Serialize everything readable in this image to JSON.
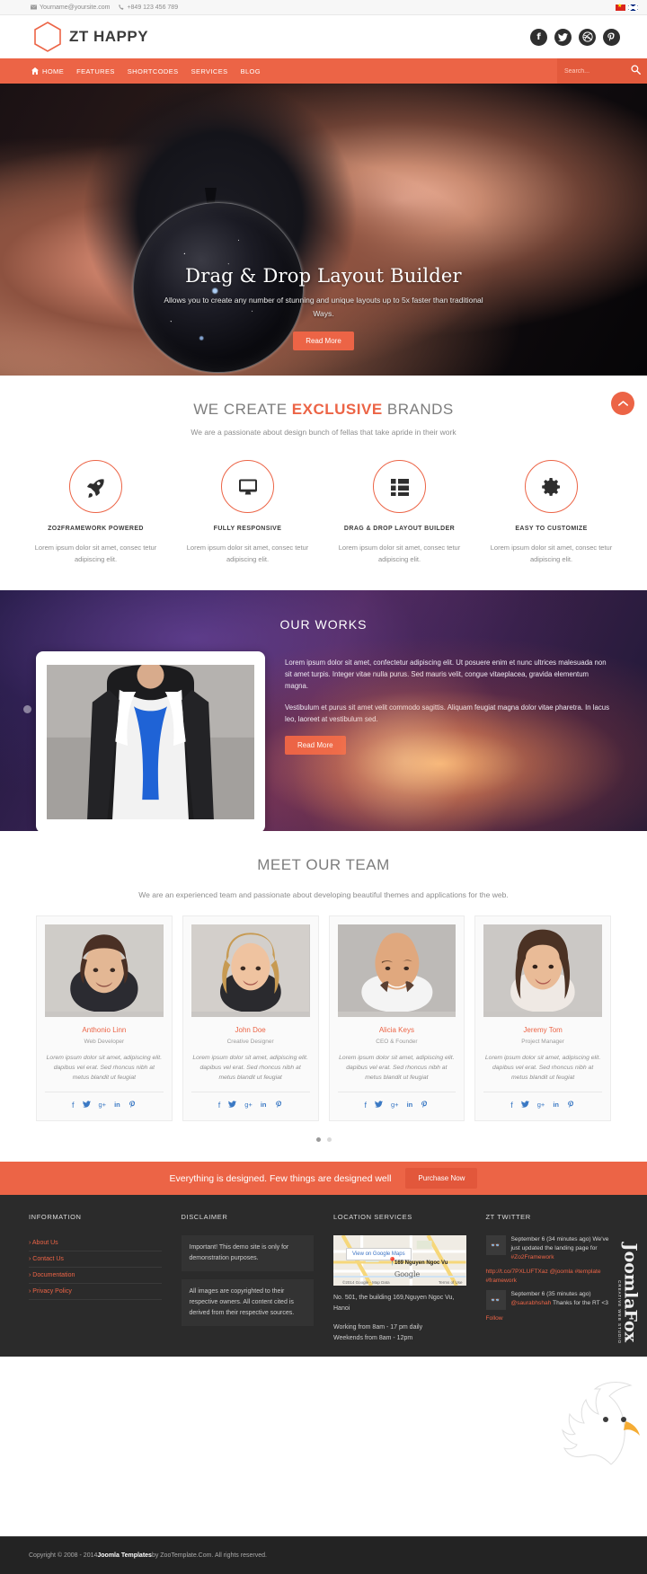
{
  "topbar": {
    "email": "Yourname@yoursite.com",
    "phone": "+849 123 456 789",
    "email_icon": "envelope-icon",
    "phone_icon": "phone-icon",
    "flags": [
      "flag-vietnam",
      "flag-uk"
    ]
  },
  "header": {
    "brand": "ZT HAPPY",
    "logo_icon": "hexagon-logo-icon",
    "social": [
      {
        "name": "facebook-icon",
        "glyph": "f"
      },
      {
        "name": "twitter-icon",
        "glyph": "ᵛ"
      },
      {
        "name": "dribbble-icon",
        "glyph": "◌"
      },
      {
        "name": "pinterest-icon",
        "glyph": "℘"
      }
    ]
  },
  "nav": {
    "items": [
      {
        "label": "HOME",
        "icon": "home-icon",
        "active": true
      },
      {
        "label": "FEATURES",
        "icon": "",
        "active": false
      },
      {
        "label": "SHORTCODES",
        "icon": "",
        "active": false
      },
      {
        "label": "SERVICES",
        "icon": "",
        "active": false
      },
      {
        "label": "BLOG",
        "icon": "",
        "active": false
      }
    ],
    "search_placeholder": "Search...",
    "search_value": "",
    "search_icon": "search-icon"
  },
  "hero": {
    "title": "Drag & Drop Layout Builder",
    "subtitle": "Allows you to create any number of stunning and unique layouts up to 5x faster than traditional Ways.",
    "button": "Read More"
  },
  "features": {
    "title_pre": "WE CREATE ",
    "title_hl": "EXCLUSIVE",
    "title_post": " BRANDS",
    "subtitle": "We are a passionate about design bunch of fellas that take apride in their work",
    "scroll_top_icon": "chevron-up-icon",
    "items": [
      {
        "icon": "rocket-icon",
        "title": "ZO2FRAMEWORK POWERED",
        "body": "Lorem ipsum dolor sit amet, consec tetur adipiscing elit."
      },
      {
        "icon": "desktop-icon",
        "title": "FULLY RESPONSIVE",
        "body": "Lorem ipsum dolor sit amet, consec tetur adipiscing elit."
      },
      {
        "icon": "list-icon",
        "title": "DRAG & DROP LAYOUT BUILDER",
        "body": "Lorem ipsum dolor sit amet, consec tetur adipiscing elit."
      },
      {
        "icon": "gear-icon",
        "title": "EASY TO CUSTOMIZE",
        "body": "Lorem ipsum dolor sit amet, consec tetur adipiscing elit."
      }
    ]
  },
  "works": {
    "title": "OUR WORKS",
    "paragraph1": "Lorem ipsum dolor sit amet, confectetur adipiscing elit. Ut posuere enim et nunc ultrices malesuada non sit amet turpis. Integer vitae nulla purus. Sed mauris velit, congue vitaeplacea, gravida elementum magna.",
    "paragraph2": "Vestibulum et purus sit amet velit commodo sagittis. Aliquam feugiat magna dolor vitae pharetra. In lacus leo, laoreet at vestibulum sed.",
    "button": "Read More",
    "prev_icon": "carousel-prev-icon",
    "next_icon": "carousel-next-icon"
  },
  "team": {
    "title": "MEET OUR TEAM",
    "subtitle": "We are an experienced team and passionate about developing beautiful themes and applications for the web.",
    "bio": "Lorem ipsum dolor sit amet, adipiscing elit. dapibus vel erat. Sed rhoncus nibh at metus blandit ut feugiat",
    "social": [
      {
        "name": "facebook-icon",
        "glyph": "f"
      },
      {
        "name": "twitter-icon",
        "glyph": "ᵛ"
      },
      {
        "name": "googleplus-icon",
        "glyph": "g+"
      },
      {
        "name": "linkedin-icon",
        "glyph": "in"
      },
      {
        "name": "pinterest-icon",
        "glyph": "℘"
      }
    ],
    "members": [
      {
        "name": "Anthonio Linn",
        "role": "Web Developer"
      },
      {
        "name": "John Doe",
        "role": "Creative Designer"
      },
      {
        "name": "Alicia Keys",
        "role": "CEO & Founder"
      },
      {
        "name": "Jeremy Tom",
        "role": "Project Manager"
      }
    ],
    "dots": [
      true,
      false
    ]
  },
  "cta": {
    "text": "Everything is designed. Few things are designed well",
    "button": "Purchase Now"
  },
  "footer": {
    "information": {
      "heading": "INFORMATION",
      "links": [
        "About Us",
        "Contact Us",
        "Documentation",
        "Privacy Policy"
      ]
    },
    "disclaimer": {
      "heading": "DISCLAIMER",
      "box1": "Important! This demo site is only for demonstration purposes.",
      "box2": "All images are copyrighted to their respective owners. All content cited is derived from their respective sources."
    },
    "location": {
      "heading": "LOCATION SERVICES",
      "map_button": "View on Google Maps",
      "map_label": "169 Nguyen Ngoc Vu",
      "map_brand": "Google",
      "map_credit_left": "©2014 Google - Map Data",
      "map_credit_right": "Terms of Use",
      "address": "No. 501, the building 169,Nguyen Ngoc Vu, Hanoi",
      "hours_line1": "Working from 8am - 17 pm daily",
      "hours_line2": "Weekends from 8am - 12pm"
    },
    "twitter": {
      "heading": "ZT TWITTER",
      "follow": "Follow",
      "tweets": [
        {
          "time": "September 6 (34 minutes ago)",
          "text": "We've just updated the landing page for",
          "tag1": "#Zo2Framework",
          "link": "http://t.co/7PXLUFTXaz @joomla",
          "tags2": "#template #framework"
        },
        {
          "time": "September 6 (35 minutes ago)",
          "text": "Thanks for the RT <3",
          "tag1": "@saurabhshah",
          "link": "",
          "tags2": ""
        }
      ]
    },
    "copyright_pre": "Copyright © 2008 - 2014 ",
    "copyright_bold": "Joomla Templates",
    "copyright_post": " by ZooTemplate.Com. All rights reserved."
  },
  "watermark": {
    "text": "JoomlaFox",
    "subtext": "CREATIVE WEB STUDIO"
  },
  "colors": {
    "accent": "#ec6446",
    "dark": "#2b2b2b",
    "text": "#8d8d8d"
  }
}
